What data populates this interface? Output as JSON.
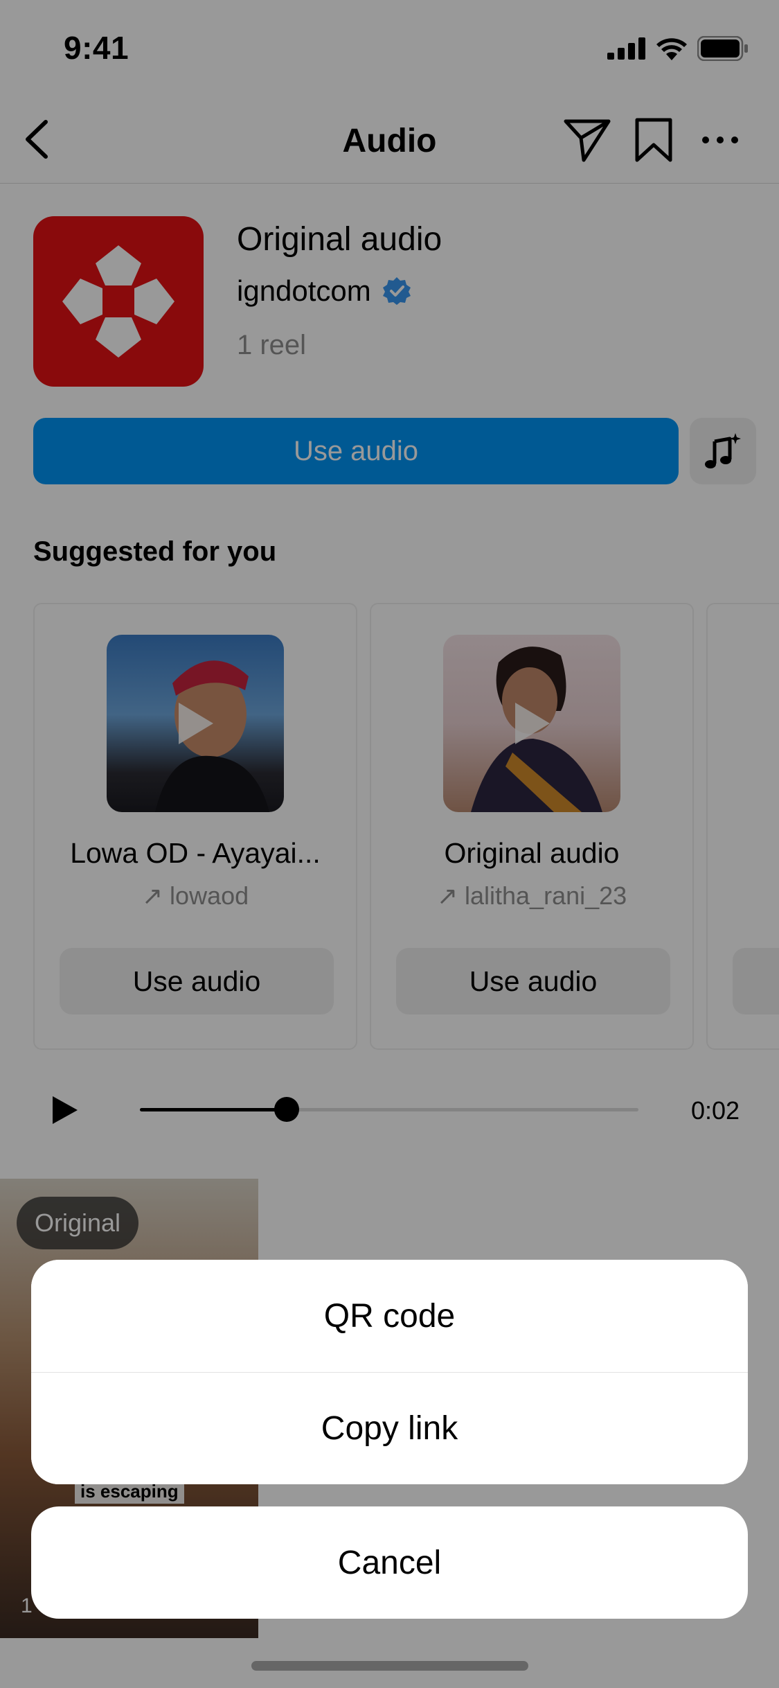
{
  "status_bar": {
    "time": "9:41"
  },
  "nav": {
    "title": "Audio"
  },
  "audio": {
    "title": "Original audio",
    "artist": "igndotcom",
    "reel_count": "1 reel",
    "use_audio_label": "Use audio",
    "brand_color": "#e41214",
    "accent_color": "#0095f6"
  },
  "suggested": {
    "title": "Suggested for you",
    "cards": [
      {
        "title": "Lowa OD - Ayayai...",
        "user": "lowaod",
        "button": "Use audio"
      },
      {
        "title": "Original audio",
        "user": "lalitha_rani_23",
        "button": "Use audio"
      }
    ]
  },
  "player": {
    "time": "0:02",
    "progress": 0.295
  },
  "reel": {
    "badge": "Original",
    "caption": "is escaping",
    "views": "1"
  },
  "sheet": {
    "items": [
      "QR code",
      "Copy link"
    ],
    "cancel": "Cancel"
  }
}
